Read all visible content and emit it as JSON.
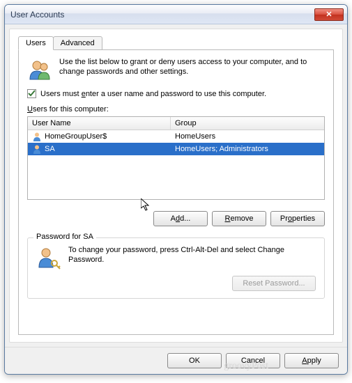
{
  "window": {
    "title": "User Accounts",
    "close_glyph": "✕"
  },
  "tabs": {
    "users": "Users",
    "advanced": "Advanced"
  },
  "intro": "Use the list below to grant or deny users access to your computer, and to change passwords and other settings.",
  "checkbox": {
    "checked": true,
    "pre": "Users must ",
    "accel": "e",
    "post": "nter a user name and password to use this computer."
  },
  "list_label_pre": "",
  "list_label_accel": "U",
  "list_label_post": "sers for this computer:",
  "columns": {
    "user": "User Name",
    "group": "Group"
  },
  "rows": [
    {
      "name": "HomeGroupUser$",
      "group": "HomeUsers",
      "selected": false
    },
    {
      "name": "SA",
      "group": "HomeUsers; Administrators",
      "selected": true
    }
  ],
  "buttons": {
    "add_pre": "A",
    "add_accel": "d",
    "add_post": "d...",
    "remove_pre": "",
    "remove_accel": "R",
    "remove_post": "emove",
    "props_pre": "Pr",
    "props_accel": "o",
    "props_post": "perties"
  },
  "password_box": {
    "title": "Password for SA",
    "text": "To change your password, press Ctrl-Alt-Del and select Change Password.",
    "reset_label": "Reset Password..."
  },
  "dialog_buttons": {
    "ok": "OK",
    "cancel": "Cancel",
    "apply_pre": "",
    "apply_accel": "A",
    "apply_post": "pply"
  },
  "watermark": "groovyPost"
}
